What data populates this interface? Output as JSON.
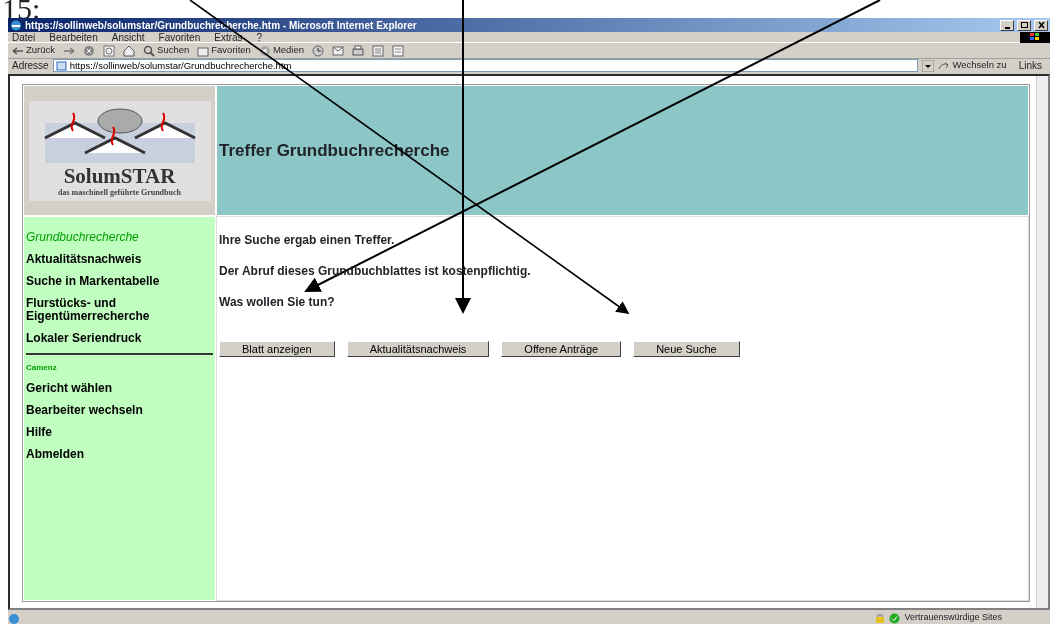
{
  "document_caption": "15:",
  "window": {
    "title": "https://sollinweb/solumstar/Grundbuchrecherche.htm - Microsoft Internet Explorer"
  },
  "menu": [
    "Datei",
    "Bearbeiten",
    "Ansicht",
    "Favoriten",
    "Extras",
    "?"
  ],
  "toolbar": [
    {
      "kind": "back",
      "label": "Zurück"
    },
    {
      "kind": "forward"
    },
    {
      "kind": "stop"
    },
    {
      "kind": "refresh"
    },
    {
      "kind": "home"
    },
    {
      "kind": "search",
      "label": "Suchen"
    },
    {
      "kind": "favorites",
      "label": "Favoriten"
    },
    {
      "kind": "media",
      "label": "Medien"
    },
    {
      "kind": "history"
    },
    {
      "kind": "mail"
    },
    {
      "kind": "print"
    },
    {
      "kind": "edit"
    },
    {
      "kind": "discuss"
    }
  ],
  "address_bar": {
    "label": "Adresse",
    "url": "https://sollinweb/solumstar/Grundbuchrecherche.htm",
    "go": "Wechseln zu",
    "links": "Links"
  },
  "logo": {
    "name": "SolumSTAR",
    "tagline": "das maschinell geführte Grundbuch"
  },
  "header": "Treffer Grundbuchrecherche",
  "sidebar": {
    "items": [
      {
        "label": "Grundbuchrecherche",
        "selected": true
      },
      {
        "label": "Aktualitätsnachweis",
        "selected": false
      },
      {
        "label": "Suche in Markentabelle",
        "selected": false
      },
      {
        "label": "Flurstücks- und Eigentümerrecherche",
        "selected": false
      },
      {
        "label": "Lokaler Seriendruck",
        "selected": false
      }
    ],
    "section": "Camenz",
    "items2": [
      {
        "label": "Gericht wählen",
        "selected": false
      },
      {
        "label": "Bearbeiter wechseln",
        "selected": false
      },
      {
        "label": "Hilfe",
        "selected": false
      },
      {
        "label": "Abmelden",
        "selected": false
      }
    ]
  },
  "messages": [
    "Ihre Suche ergab einen Treffer.",
    "Der Abruf dieses Grundbuchblattes ist kostenpflichtig.",
    "Was wollen Sie tun?"
  ],
  "buttons": [
    "Blatt anzeigen",
    "Aktualitätsnachweis",
    "Offene Anträge",
    "Neue Suche"
  ],
  "status_bar": {
    "zone": "Vertrauenswürdige Sites"
  }
}
